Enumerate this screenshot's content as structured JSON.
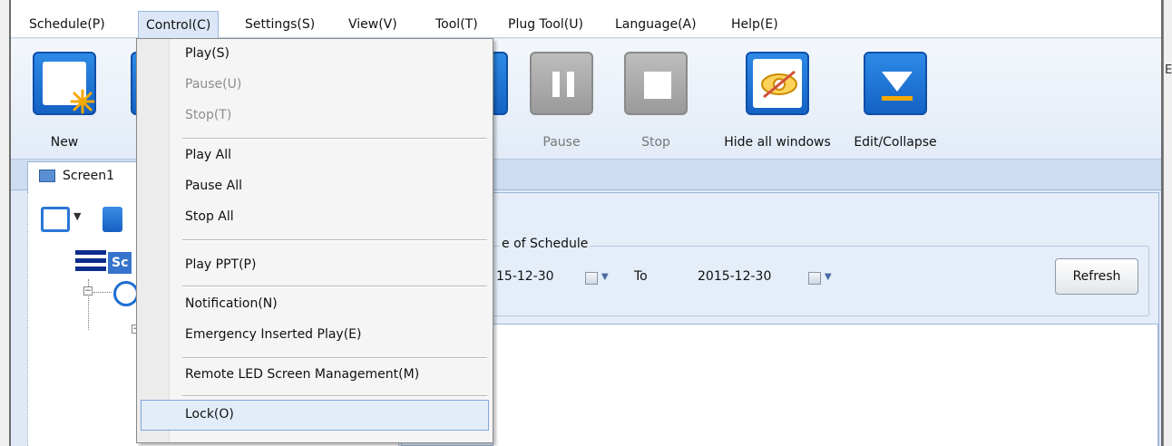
{
  "menubar": {
    "items": [
      "Schedule(P)",
      "Control(C)",
      "Settings(S)",
      "View(V)",
      "Tool(T)",
      "Plug Tool(U)",
      "Language(A)",
      "Help(E)"
    ]
  },
  "toolbar": {
    "new_label": "New",
    "pause_label": "Pause",
    "stop_label": "Stop",
    "hide_label": "Hide all windows",
    "edit_label": "Edit/Collapse"
  },
  "tabs": {
    "screen1": "Screen1"
  },
  "tree": {
    "selected_label": "Sc"
  },
  "schedule_filter": {
    "group_title": "e of Schedule",
    "from_date": "15-12-30",
    "to_label": "To",
    "to_date": "2015-12-30",
    "refresh_label": "Refresh"
  },
  "control_menu": {
    "play": "Play(S)",
    "pause": "Pause(U)",
    "stop": "Stop(T)",
    "play_all": "Play All",
    "pause_all": "Pause All",
    "stop_all": "Stop All",
    "play_ppt": "Play PPT(P)",
    "notification": "Notification(N)",
    "emergency": "Emergency Inserted Play(E)",
    "remote_led": "Remote LED Screen Management(M)",
    "lock": "Lock(O)"
  },
  "colors": {
    "accent": "#1462c4",
    "highlight": "#e3edf9",
    "toolbar_bg": "#e2ebf7"
  },
  "icons": [
    "new-icon",
    "pause-icon",
    "stop-icon",
    "hide-windows-icon",
    "edit-collapse-icon",
    "monitor-icon",
    "add-program-icon",
    "trash-icon",
    "list-icon",
    "clock-icon",
    "calendar-icon"
  ]
}
